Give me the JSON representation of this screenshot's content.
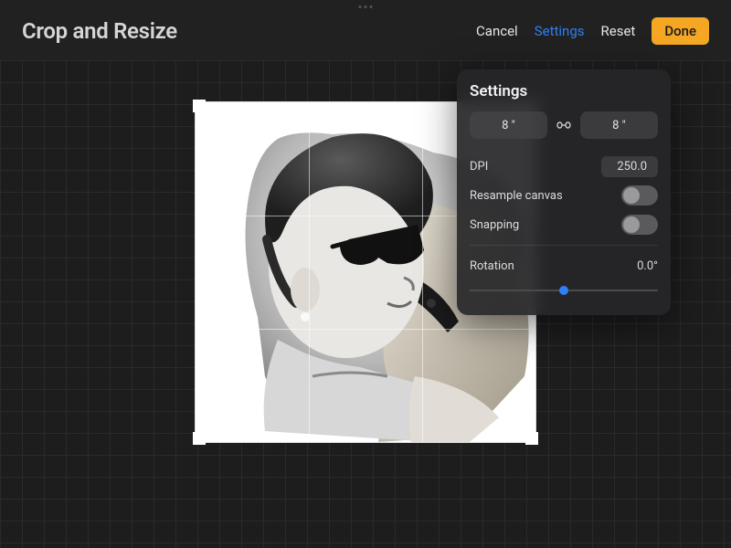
{
  "header": {
    "title": "Crop and Resize",
    "cancel": "Cancel",
    "settings": "Settings",
    "reset": "Reset",
    "done": "Done"
  },
  "settings_panel": {
    "title": "Settings",
    "width": "8 \"",
    "height": "8 \"",
    "dpi_label": "DPI",
    "dpi_value": "250.0",
    "resample_label": "Resample canvas",
    "resample_on": false,
    "snapping_label": "Snapping",
    "snapping_on": false,
    "rotation_label": "Rotation",
    "rotation_value": "0.0°",
    "rotation_percent": 50
  },
  "colors": {
    "accent_blue": "#2f7ff6",
    "accent_orange": "#f5a623"
  }
}
